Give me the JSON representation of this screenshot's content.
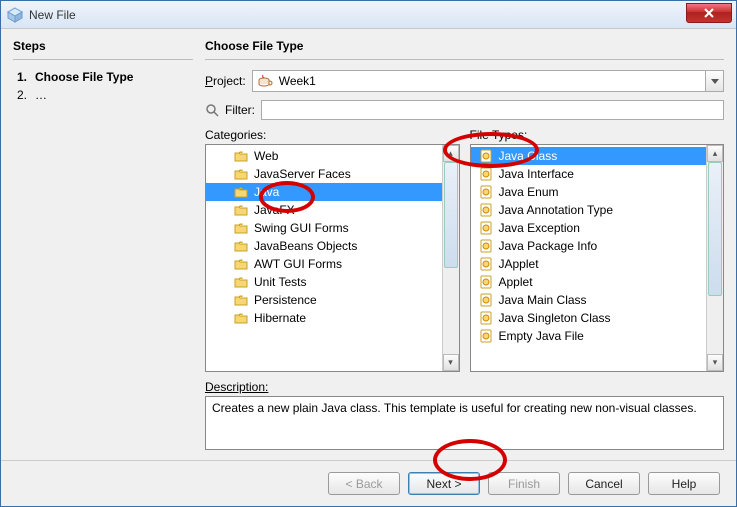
{
  "window": {
    "title": "New File"
  },
  "steps": {
    "heading": "Steps",
    "items": [
      {
        "num": "1.",
        "label": "Choose File Type",
        "active": true
      },
      {
        "num": "2.",
        "label": "…",
        "active": false
      }
    ]
  },
  "main": {
    "heading": "Choose File Type",
    "projectLabel": "Project:",
    "projectValue": "Week1",
    "filterLabel": "Filter:",
    "filterValue": "",
    "categoriesLabel": "Categories:",
    "fileTypesLabel": "File Types:",
    "categories": [
      "Web",
      "JavaServer Faces",
      "Java",
      "JavaFX",
      "Swing GUI Forms",
      "JavaBeans Objects",
      "AWT GUI Forms",
      "Unit Tests",
      "Persistence",
      "Hibernate"
    ],
    "categorySelectedIndex": 2,
    "fileTypes": [
      "Java Class",
      "Java Interface",
      "Java Enum",
      "Java Annotation Type",
      "Java Exception",
      "Java Package Info",
      "JApplet",
      "Applet",
      "Java Main Class",
      "Java Singleton Class",
      "Empty Java File"
    ],
    "fileTypeSelectedIndex": 0,
    "descriptionLabel": "Description:",
    "descriptionText": "Creates a new plain Java class. This template is useful for creating new non-visual classes."
  },
  "buttons": {
    "back": "< Back",
    "next": "Next >",
    "finish": "Finish",
    "cancel": "Cancel",
    "help": "Help"
  }
}
